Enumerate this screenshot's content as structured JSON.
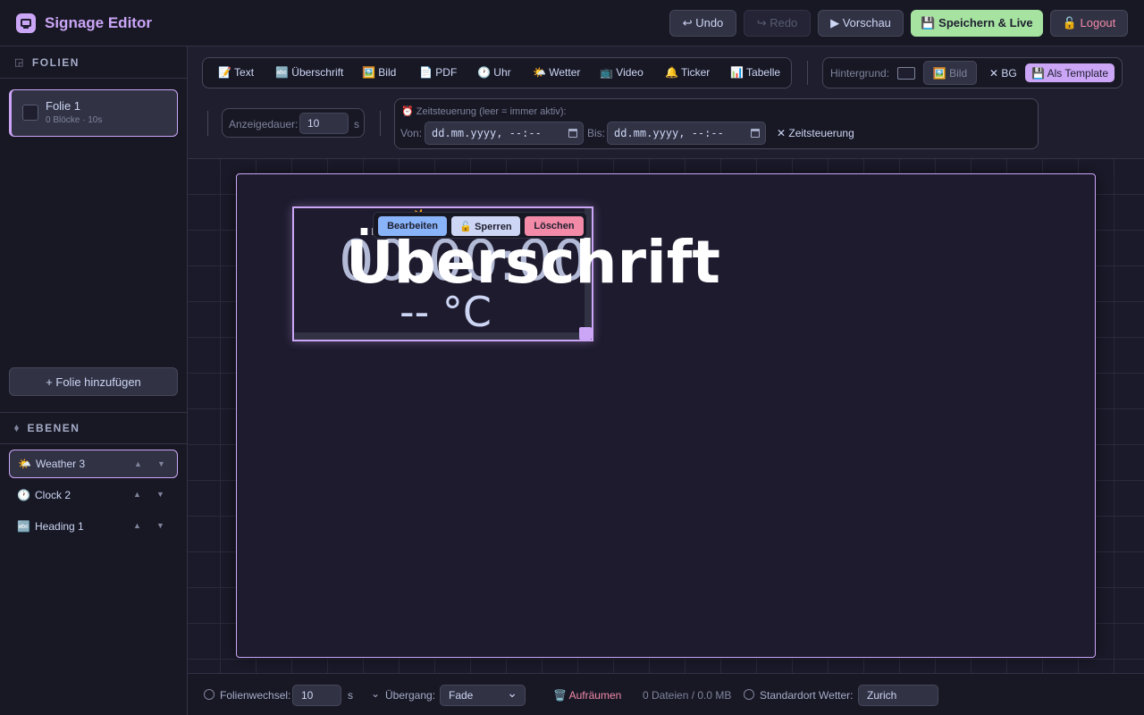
{
  "header": {
    "title": "Signage Editor",
    "undo": "↩ Undo",
    "redo": "↪ Redo",
    "preview": "▶ Vorschau",
    "save_live": "💾 Speichern & Live",
    "logout": "🔓 Logout"
  },
  "sidebar": {
    "slides_heading": "FOLIEN",
    "slides": [
      {
        "name": "Folie 1",
        "meta": "0 Blöcke · 10s"
      }
    ],
    "add_slide": "+ Folie hinzufügen",
    "layers_heading": "EBENEN",
    "layers": [
      {
        "icon": "🌤️",
        "label": "Weather 3"
      },
      {
        "icon": "🕐",
        "label": "Clock 2"
      },
      {
        "icon": "🔤",
        "label": "Heading 1"
      }
    ]
  },
  "toolbar": {
    "tools": [
      "📝 Text",
      "🔤 Überschrift",
      "🖼️ Bild",
      "📄 PDF",
      "🕐 Uhr",
      "🌤️ Wetter",
      "📺 Video",
      "🔔 Ticker",
      "📊 Tabelle"
    ],
    "background_label": "Hintergrund:",
    "background_image": "🖼️ Bild",
    "background_clear": "✕ BG",
    "as_template": "💾 Als Template",
    "duration_label": "Anzeigedauer:",
    "duration_value": "10",
    "duration_unit": "s",
    "schedule_title": "⏰ Zeitsteuerung (leer = immer aktiv):",
    "from_label": "Von:",
    "from_placeholder": "dd.mm.yyyy, --:--",
    "to_label": "Bis:",
    "to_placeholder": "dd.mm.yyyy, --:--",
    "schedule_clear": "✕ Zeitsteuerung"
  },
  "canvas": {
    "clock_text": "00:00:00",
    "weather_icon": "⛅",
    "temperature": "-- °C",
    "heading_text": "Überschrift",
    "actions": {
      "edit": "Bearbeiten",
      "lock": "🔓 Sperren",
      "delete": "Löschen"
    },
    "colors": {
      "accent": "#cba6f7",
      "edit": "#89b4fa",
      "delete": "#f38ba8",
      "save": "#a6e3a1"
    }
  },
  "footer": {
    "interval_label": "Folienwechsel:",
    "interval_value": "10",
    "interval_unit": "s",
    "transition_label": "Übergang:",
    "transition_value": "Fade",
    "cleanup": "🗑️ Aufräumen",
    "files": "0 Dateien / 0.0 MB",
    "weather_location_label": "Standardort Wetter:",
    "weather_location_value": "Zurich"
  }
}
